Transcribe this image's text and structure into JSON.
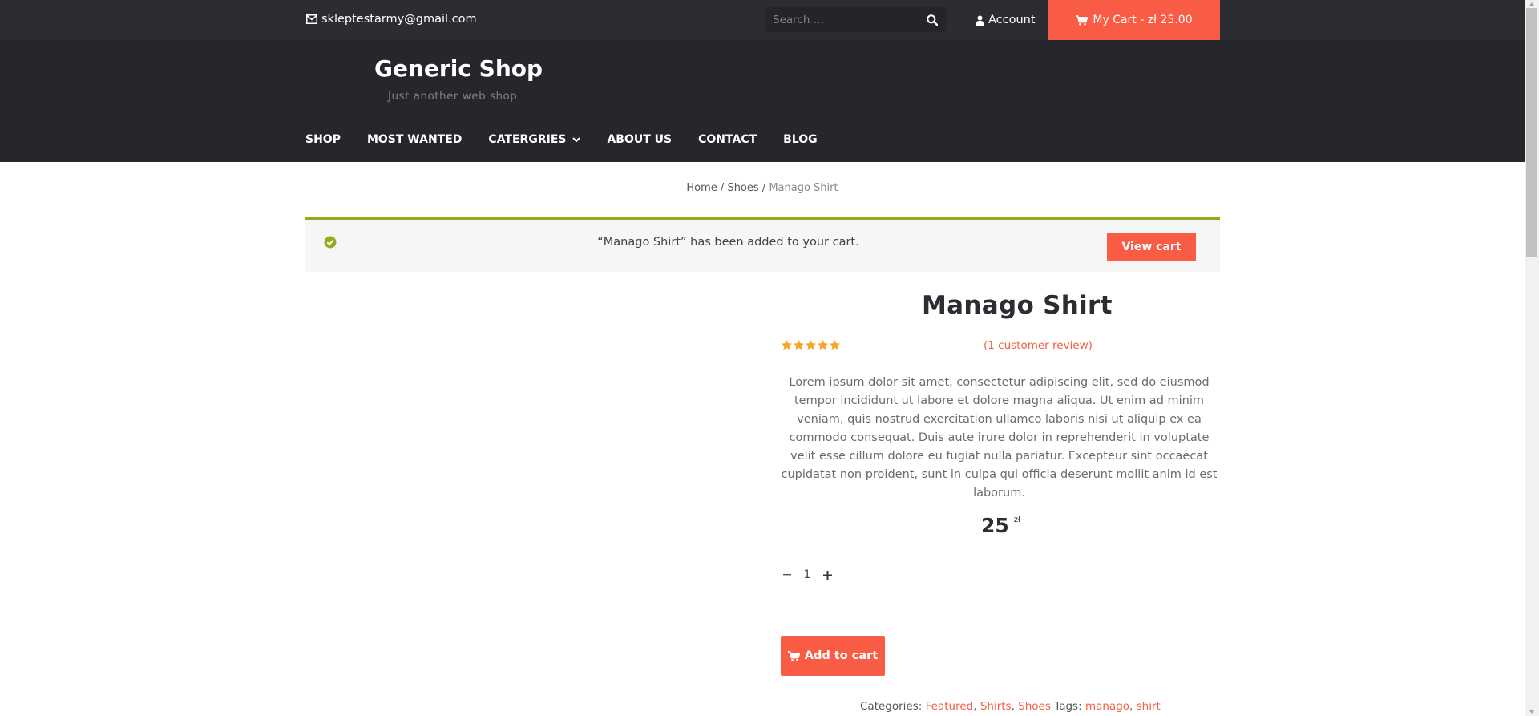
{
  "topbar": {
    "email": "skleptestarmy@gmail.com",
    "search_placeholder": "Search …",
    "account_label": "Account",
    "cart_label": "My Cart - zł 25.00"
  },
  "header": {
    "site_title": "Generic Shop",
    "tagline": "Just another web shop",
    "nav": [
      "SHOP",
      "MOST WANTED",
      "CATERGRIES",
      "ABOUT US",
      "CONTACT",
      "BLOG"
    ]
  },
  "breadcrumb": {
    "home": "Home",
    "sep1": " / ",
    "category": "Shoes",
    "sep2": " / ",
    "current": "Manago Shirt"
  },
  "notice": {
    "message": "“Manago Shirt” has been added to your cart.",
    "button": "View cart"
  },
  "product": {
    "title": "Manago Shirt",
    "rating": 5,
    "rating_max": 5,
    "review_link": "(1 customer review)",
    "description": "Lorem ipsum dolor sit amet, consectetur adipiscing elit, sed do eiusmod tempor incididunt ut labore et dolore magna aliqua. Ut enim ad minim veniam, quis nostrud exercitation ullamco laboris nisi ut aliquip ex ea commodo consequat. Duis aute irure dolor in reprehenderit in voluptate velit esse cillum dolore eu fugiat nulla pariatur. Excepteur sint occaecat cupidatat non proident, sunt in culpa qui officia deserunt mollit anim id est laborum.",
    "price": "25",
    "currency": "zł",
    "quantity": "1",
    "add_to_cart": "Add to cart",
    "categories_label": "Categories:",
    "categories": [
      "Featured",
      "Shirts",
      "Shoes"
    ],
    "tags_label": "Tags:",
    "tags": [
      "manago",
      "shirt"
    ]
  },
  "colors": {
    "accent": "#f85c44",
    "topbar": "#2c2d33",
    "header": "#26272d",
    "notice_border": "#8fae1b",
    "star": "#f5a623"
  },
  "icons": {
    "email": "envelope-icon",
    "search": "search-icon",
    "account": "user-icon",
    "cart": "cart-icon",
    "dropdown": "chevron-down-icon",
    "notice": "check-circle-icon",
    "rating": "star-icon"
  }
}
